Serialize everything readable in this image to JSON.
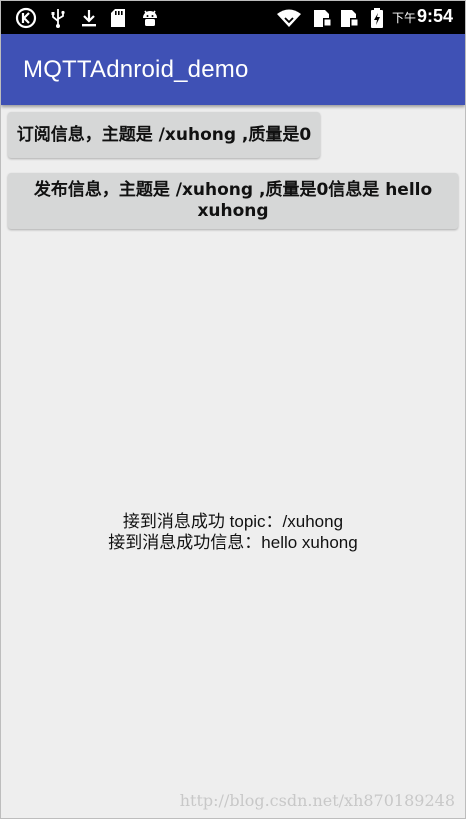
{
  "status_bar": {
    "time_prefix": "下午",
    "time": "9:54",
    "icons": [
      "k-app-icon",
      "usb-icon",
      "download-icon",
      "sd-card-icon",
      "android-debug-icon",
      "wifi-icon",
      "sim-card-1-icon",
      "sim-card-2-icon",
      "battery-charging-icon"
    ]
  },
  "app_bar": {
    "title": "MQTTAdnroid_demo",
    "color": "#3f51b5"
  },
  "buttons": {
    "subscribe_label": "订阅信息，主题是 /xuhong  ,质量是0",
    "publish_label": "发布信息，主题是 /xuhong ,质量是0信息是 hello xuhong"
  },
  "messages": {
    "line1": "接到消息成功 topic：/xuhong",
    "line2": "接到消息成功信息：hello xuhong"
  },
  "watermark": "http://blog.csdn.net/xh870189248"
}
